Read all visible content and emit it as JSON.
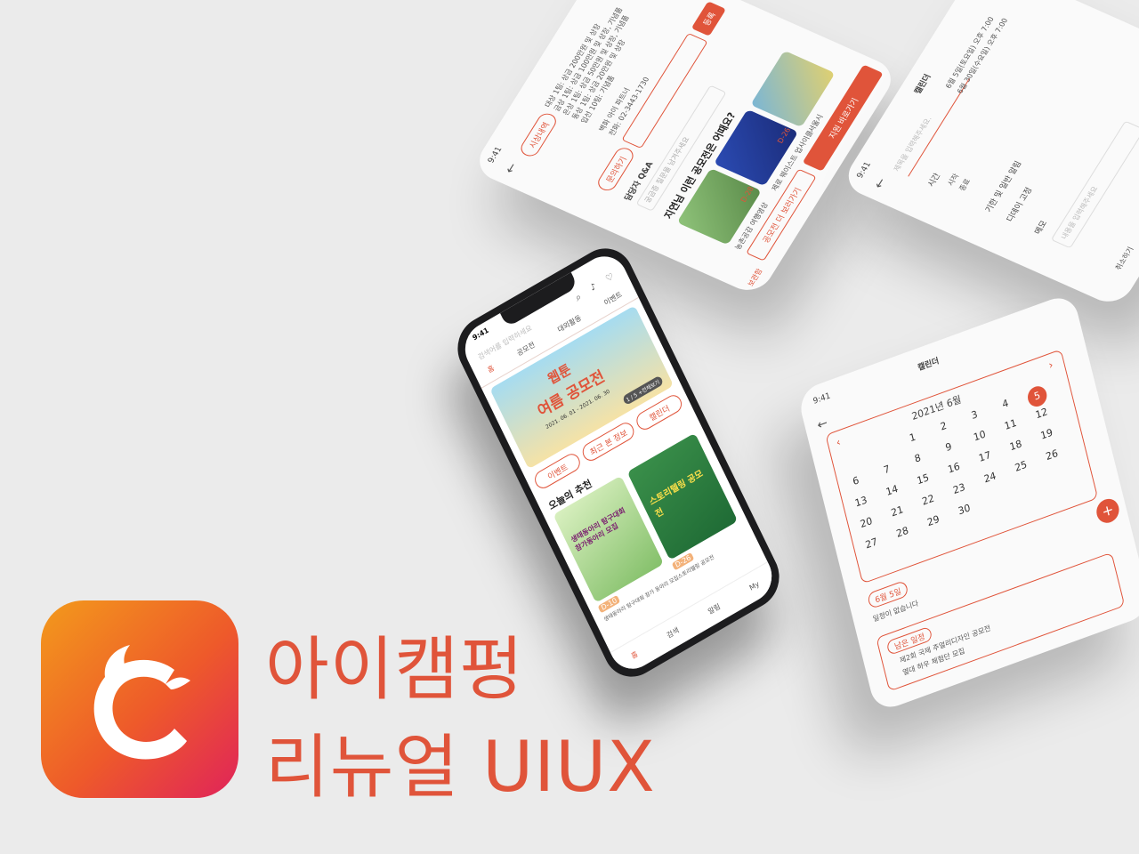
{
  "title": {
    "line1": "아이캠펑",
    "line2": "리뉴얼 UIUX"
  },
  "colors": {
    "accent": "#e0543a",
    "bg": "#ebebeb",
    "logo_from": "#f39a1c",
    "logo_to": "#e0235a"
  },
  "phone": {
    "time": "9:41",
    "search_placeholder": "검색어를 입력하세요",
    "tabs": [
      "홈",
      "공모전",
      "대외활동",
      "이벤트"
    ],
    "banner": {
      "line1": "웹툰",
      "line2": "여름 공모전",
      "dates": "2021. 06. 01 - 2021. 06. 30",
      "pager": "1 / 5 +전체보기"
    },
    "quick": [
      "이벤트",
      "최근 본 정보",
      "캘린더"
    ],
    "section_title": "오늘의 추천",
    "cards": [
      {
        "title": "생태동아리 탐구대회 참가동아리 모집",
        "dday": "D-10",
        "caption": "생태동아리 탐구대회 참가 동아리 모집"
      },
      {
        "title": "스토리텔링 공모전",
        "dday": "D-26",
        "caption": "스토리텔링 공모전"
      }
    ],
    "nav": [
      "홈",
      "검색",
      "알림",
      "My"
    ]
  },
  "detail_screen": {
    "time": "9:41",
    "prize_lines": [
      "대상 1팀: 상금 200만원 및 상장",
      "금상 1팀: 상금 100만원 및 상장, 기념품",
      "은상 1팀: 상금 50만원 및 상장, 기념품",
      "동상 1팀: 상금 20만원 및 상장",
      "입선 10팀: 기념품"
    ],
    "tag": "시상내역",
    "contact1": "벽화 아이 파트너",
    "contact2": "전화: 02-3443-1730",
    "ask_btn": "문의하기",
    "reg_btn": "등록",
    "qa_title": "담당자 Q&A",
    "qa_placeholder": "궁금증 질문을 남겨주세요",
    "rec_title": "지연님 이런 공모전은 어때요?",
    "rec_cards": [
      {
        "caption": "농촌공감 여행영상",
        "dday": "D-28"
      },
      {
        "caption": "제로 웨이스트 업사이클",
        "dday": "D-26"
      },
      {
        "caption": "서울시",
        "dday": ""
      }
    ],
    "more_btn": "공모전 더 보러가기",
    "apply_btn": "지원 바로가기",
    "fav": "보관함"
  },
  "add_screen": {
    "time": "9:41",
    "title": "캘린더",
    "title_placeholder": "제목을 입력해주세요.",
    "time_label": "시간",
    "start": "시작",
    "end": "종료",
    "start_val": "6월 5일(토요일) 오후 7:00",
    "end_val": "6월 30일(수요일) 오후 7:00",
    "alarm": "기한 및 일반 알림",
    "dday": "디데이 고정",
    "memo": "메모",
    "memo_placeholder": "내용을 입력해주세요",
    "cancel": "취소하기"
  },
  "calendar_screen": {
    "time": "9:41",
    "title": "캘린더",
    "month": "2021년 6월",
    "days": [
      "1",
      "2",
      "3",
      "4",
      "5",
      "6",
      "7",
      "8",
      "9",
      "10",
      "11",
      "12",
      "13",
      "14",
      "15",
      "16",
      "17",
      "18",
      "19",
      "20",
      "21",
      "22",
      "23",
      "24",
      "25",
      "26",
      "27",
      "28",
      "29",
      "30"
    ],
    "selected": "6월 5일",
    "note": "일정이 없습니다",
    "badge": "남은 일정",
    "events": [
      "제2회 국제 주얼리디자인 공모전",
      "열대 하우 체험단 모집"
    ]
  }
}
